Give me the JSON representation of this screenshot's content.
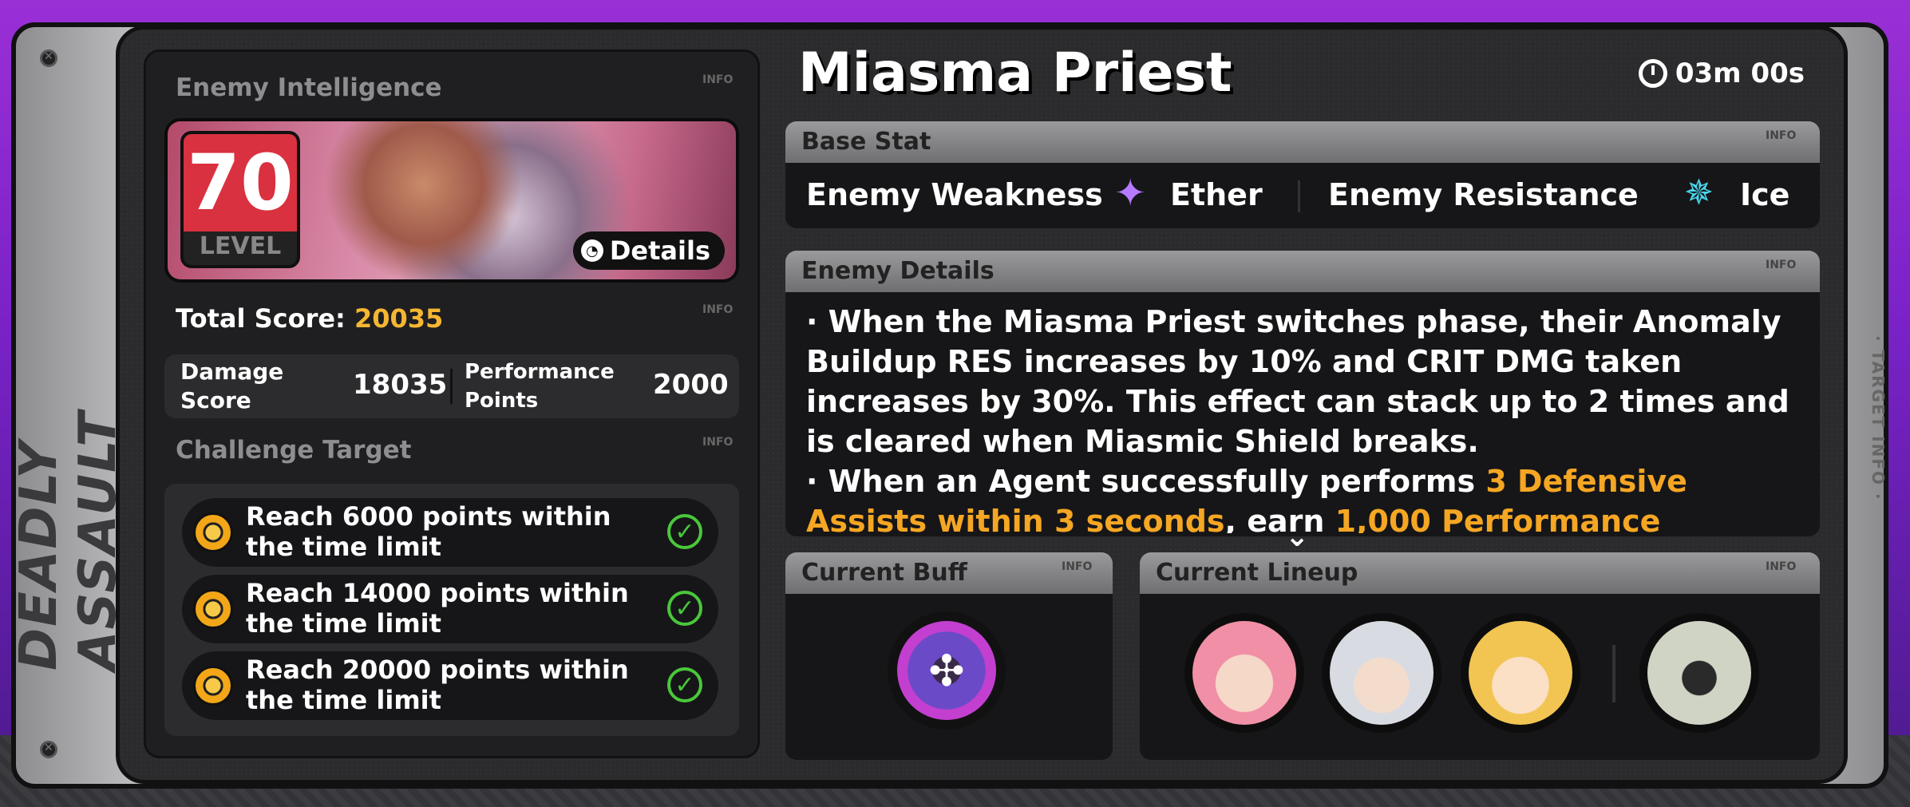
{
  "side": {
    "left_label": "DEADLY ASSAULT",
    "right_label": "· TARGET INFO ·"
  },
  "left": {
    "intel_title": "Enemy Intelligence",
    "info": "INFO",
    "level": "70",
    "level_label": "LEVEL",
    "details_label": "Details",
    "total_score_label": "Total Score:",
    "total_score_value": "20035",
    "damage_score_label": "Damage Score",
    "damage_score_value": "18035",
    "performance_label": "Performance Points",
    "performance_value": "2000",
    "challenge_title": "Challenge Target",
    "targets": [
      {
        "text": "Reach 6000 points within the time limit"
      },
      {
        "text": "Reach 14000 points within the time limit"
      },
      {
        "text": "Reach 20000 points within the time limit"
      }
    ]
  },
  "enemy": {
    "name": "Miasma Priest",
    "timer": "03m 00s"
  },
  "base_stat": {
    "title": "Base Stat",
    "weakness_label": "Enemy Weakness",
    "weakness_value": "Ether",
    "resistance_label": "Enemy Resistance",
    "resistance_value": "Ice"
  },
  "details": {
    "title": "Enemy Details",
    "p1": "· When the Miasma Priest switches phase, their Anomaly Buildup RES increases by 10% and CRIT DMG taken increases by 30%. This effect can stack up to 2 times and is cleared when Miasmic Shield breaks.",
    "p2_pre": "· When an Agent successfully performs ",
    "p2_hl1": "3 Defensive Assists within 3 seconds",
    "p2_mid": ", earn ",
    "p2_hl2": "1,000 Performance"
  },
  "buff": {
    "title": "Current Buff"
  },
  "lineup": {
    "title": "Current Lineup"
  },
  "colors": {
    "accent_orange": "#f5b731",
    "level_red": "#d9313f",
    "check_green": "#4ac73b"
  }
}
